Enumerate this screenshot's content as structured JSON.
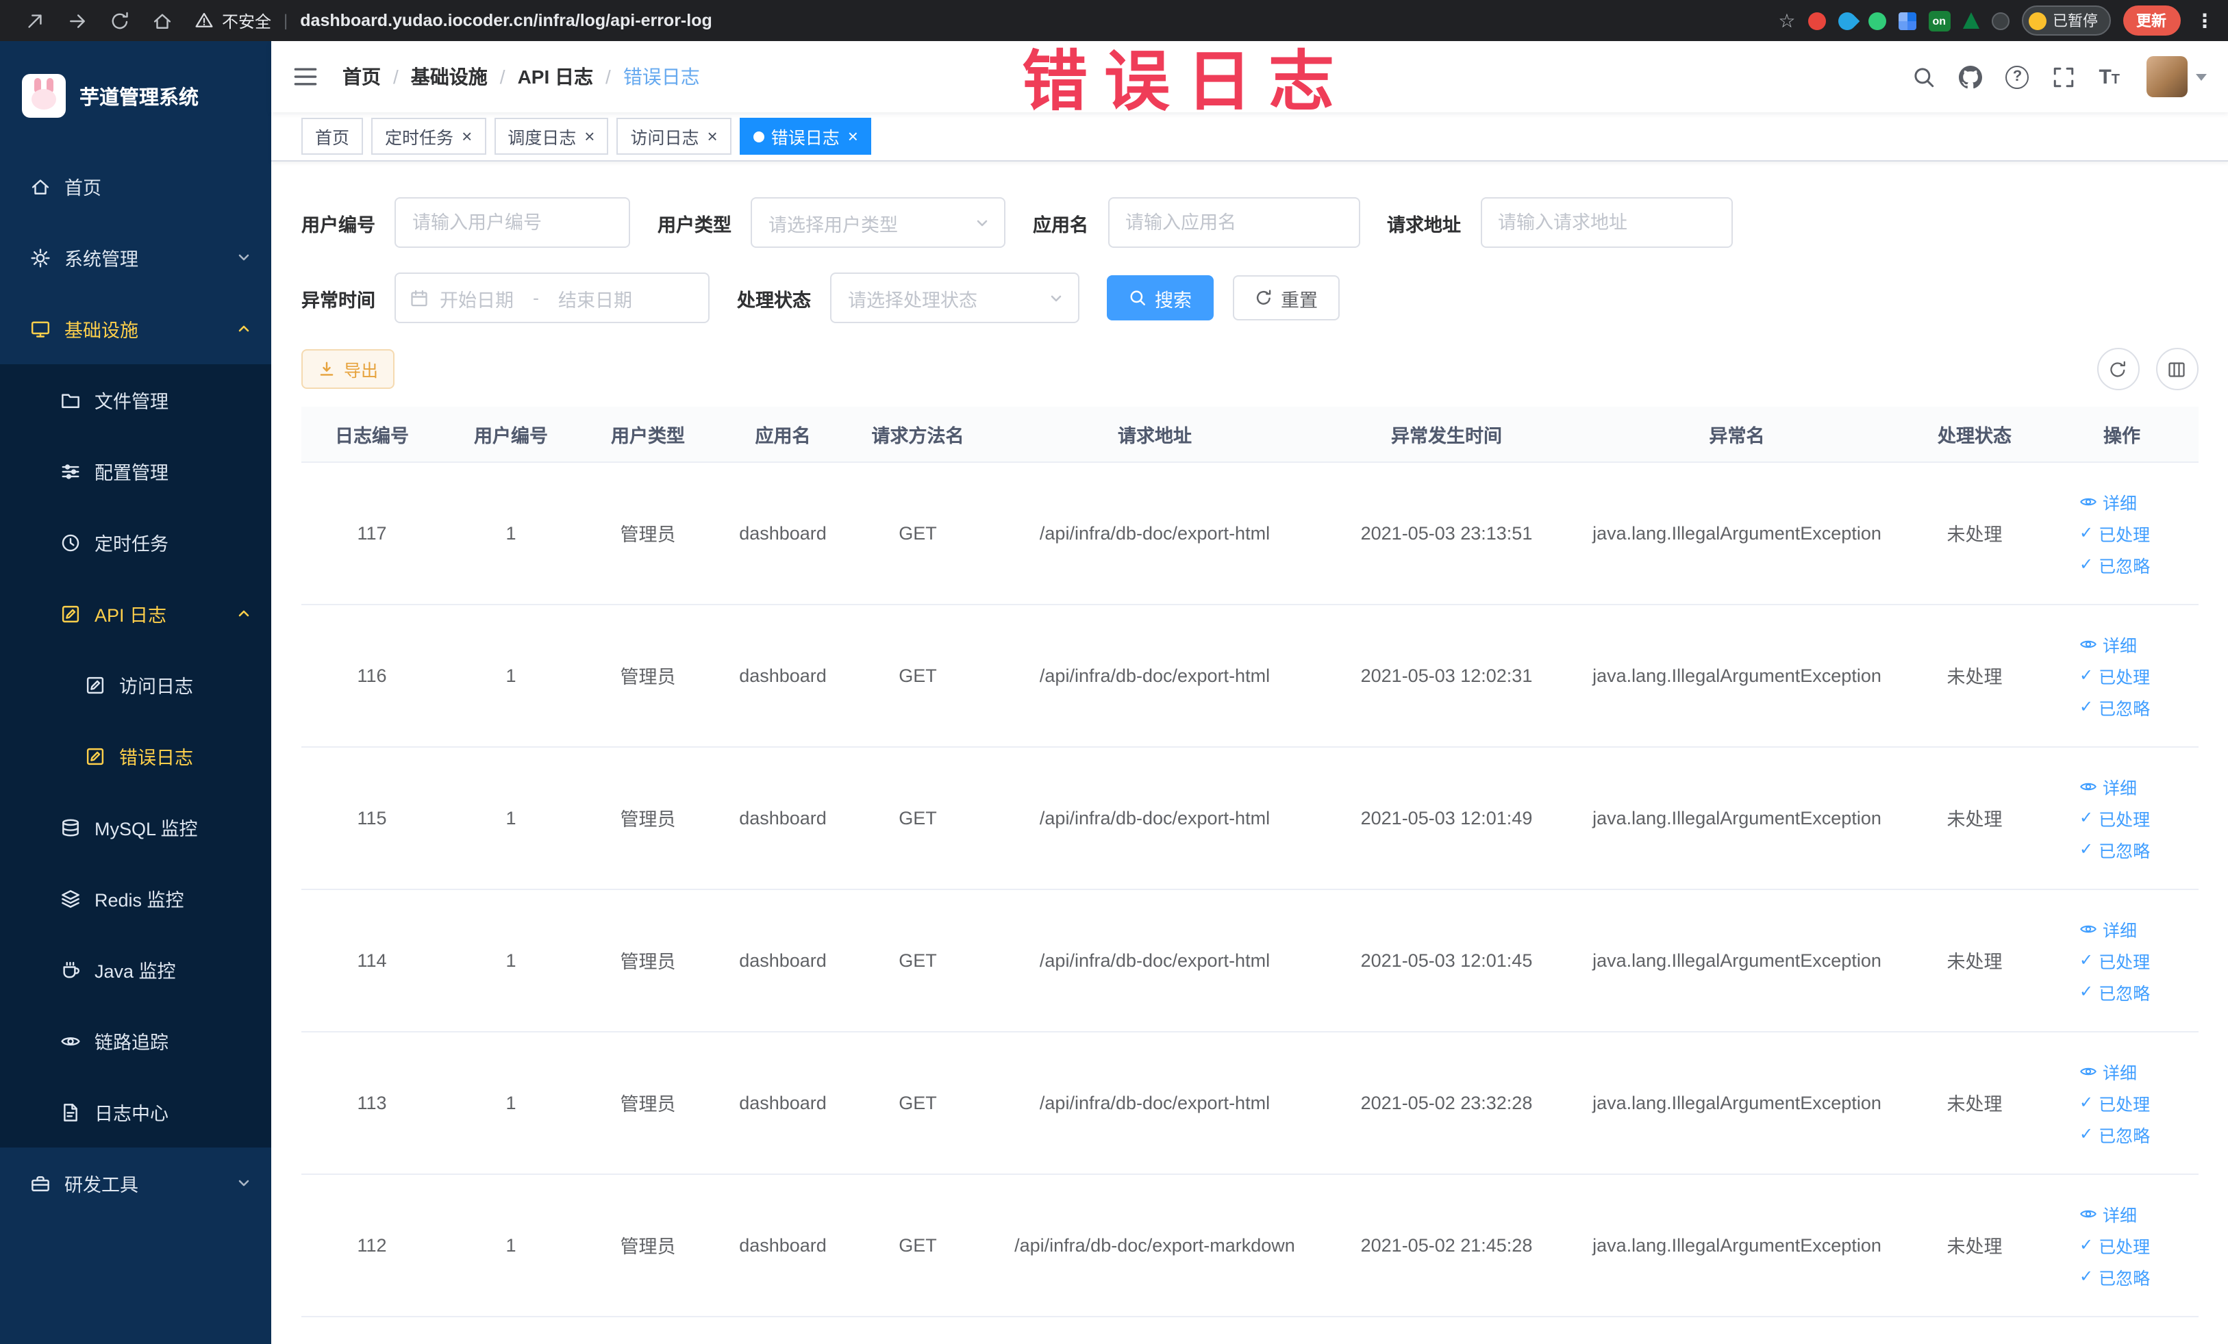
{
  "browser": {
    "security_label": "不安全",
    "url_separator": "|",
    "url": "dashboard.yudao.iocoder.cn/infra/log/api-error-log",
    "extension_on_badge": "on",
    "paused_badge": "已暂停",
    "update_button": "更新"
  },
  "watermark_text": "错误日志",
  "sidebar": {
    "logo_title": "芋道管理系统",
    "menu": {
      "home": "首页",
      "system": "系统管理",
      "infra": "基础设施",
      "file": "文件管理",
      "config": "配置管理",
      "job": "定时任务",
      "api_log": "API 日志",
      "access_log": "访问日志",
      "error_log": "错误日志",
      "mysql": "MySQL 监控",
      "redis": "Redis 监控",
      "java": "Java 监控",
      "trace": "链路追踪",
      "log_center": "日志中心",
      "dev_tools": "研发工具"
    }
  },
  "breadcrumb": {
    "items": [
      "首页",
      "基础设施",
      "API 日志",
      "错误日志"
    ],
    "separator": "/"
  },
  "tabs": [
    {
      "label": "首页",
      "closable": false,
      "active": false
    },
    {
      "label": "定时任务",
      "closable": true,
      "active": false
    },
    {
      "label": "调度日志",
      "closable": true,
      "active": false
    },
    {
      "label": "访问日志",
      "closable": true,
      "active": false
    },
    {
      "label": "错误日志",
      "closable": true,
      "active": true
    }
  ],
  "filters": {
    "user_id": {
      "label": "用户编号",
      "placeholder": "请输入用户编号"
    },
    "user_type": {
      "label": "用户类型",
      "placeholder": "请选择用户类型"
    },
    "app_name": {
      "label": "应用名",
      "placeholder": "请输入应用名"
    },
    "request_url": {
      "label": "请求地址",
      "placeholder": "请输入请求地址"
    },
    "exception_time": {
      "label": "异常时间",
      "start_placeholder": "开始日期",
      "separator": "-",
      "end_placeholder": "结束日期"
    },
    "process_status": {
      "label": "处理状态",
      "placeholder": "请选择处理状态"
    },
    "search_button": "搜索",
    "reset_button": "重置"
  },
  "toolbar": {
    "export_button": "导出"
  },
  "table": {
    "columns": [
      "日志编号",
      "用户编号",
      "用户类型",
      "应用名",
      "请求方法名",
      "请求地址",
      "异常发生时间",
      "异常名",
      "处理状态",
      "操作"
    ],
    "actions": {
      "detail": "详细",
      "processed": "已处理",
      "ignored": "已忽略"
    },
    "rows": [
      {
        "log_id": "117",
        "user_id": "1",
        "user_type": "管理员",
        "app_name": "dashboard",
        "method": "GET",
        "url": "/api/infra/db-doc/export-html",
        "time": "2021-05-03 23:13:51",
        "exception": "java.lang.IllegalArgumentException",
        "status": "未处理"
      },
      {
        "log_id": "116",
        "user_id": "1",
        "user_type": "管理员",
        "app_name": "dashboard",
        "method": "GET",
        "url": "/api/infra/db-doc/export-html",
        "time": "2021-05-03 12:02:31",
        "exception": "java.lang.IllegalArgumentException",
        "status": "未处理"
      },
      {
        "log_id": "115",
        "user_id": "1",
        "user_type": "管理员",
        "app_name": "dashboard",
        "method": "GET",
        "url": "/api/infra/db-doc/export-html",
        "time": "2021-05-03 12:01:49",
        "exception": "java.lang.IllegalArgumentException",
        "status": "未处理"
      },
      {
        "log_id": "114",
        "user_id": "1",
        "user_type": "管理员",
        "app_name": "dashboard",
        "method": "GET",
        "url": "/api/infra/db-doc/export-html",
        "time": "2021-05-03 12:01:45",
        "exception": "java.lang.IllegalArgumentException",
        "status": "未处理"
      },
      {
        "log_id": "113",
        "user_id": "1",
        "user_type": "管理员",
        "app_name": "dashboard",
        "method": "GET",
        "url": "/api/infra/db-doc/export-html",
        "time": "2021-05-02 23:32:28",
        "exception": "java.lang.IllegalArgumentException",
        "status": "未处理"
      },
      {
        "log_id": "112",
        "user_id": "1",
        "user_type": "管理员",
        "app_name": "dashboard",
        "method": "GET",
        "url": "/api/infra/db-doc/export-markdown",
        "time": "2021-05-02 21:45:28",
        "exception": "java.lang.IllegalArgumentException",
        "status": "未处理"
      }
    ]
  },
  "icons": {
    "close": "×",
    "check": "✓",
    "question": "?",
    "star": "☆",
    "ellipsis": "⋮",
    "font_large": "T",
    "font_small": "T"
  }
}
